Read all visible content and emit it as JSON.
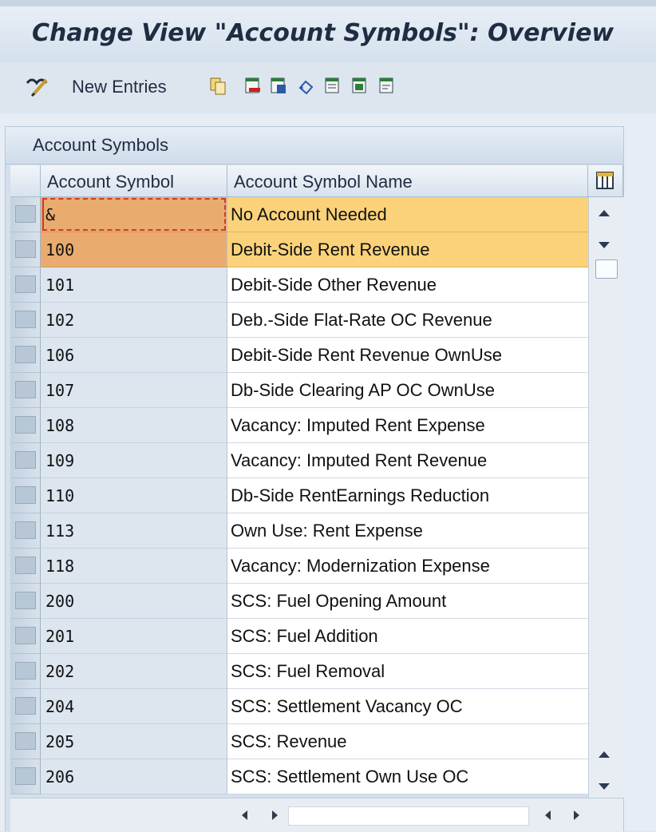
{
  "title": "Change View \"Account Symbols\": Overview",
  "toolbar": {
    "new_entries_label": "New Entries",
    "icons": [
      "glasses-pencil-icon",
      "copy-icon",
      "delete-icon",
      "undo-icon",
      "select-all-icon",
      "select-block-icon",
      "deselect-all-icon"
    ]
  },
  "panel": {
    "title": "Account Symbols",
    "columns": {
      "symbol": "Account Symbol",
      "name": "Account Symbol Name"
    }
  },
  "rows": [
    {
      "symbol": "&",
      "name": "No Account Needed"
    },
    {
      "symbol": "100",
      "name": "Debit-Side Rent Revenue"
    },
    {
      "symbol": "101",
      "name": "Debit-Side Other Revenue"
    },
    {
      "symbol": "102",
      "name": "Deb.-Side Flat-Rate OC Revenue"
    },
    {
      "symbol": "106",
      "name": "Debit-Side Rent Revenue OwnUse"
    },
    {
      "symbol": "107",
      "name": "Db-Side Clearing AP OC OwnUse"
    },
    {
      "symbol": "108",
      "name": "Vacancy: Imputed Rent Expense"
    },
    {
      "symbol": "109",
      "name": "Vacancy: Imputed Rent Revenue"
    },
    {
      "symbol": "110",
      "name": "Db-Side RentEarnings Reduction"
    },
    {
      "symbol": "113",
      "name": "Own Use: Rent Expense"
    },
    {
      "symbol": "118",
      "name": "Vacancy: Modernization Expense"
    },
    {
      "symbol": "200",
      "name": "SCS: Fuel Opening Amount"
    },
    {
      "symbol": "201",
      "name": "SCS: Fuel Addition"
    },
    {
      "symbol": "202",
      "name": "SCS: Fuel Removal"
    },
    {
      "symbol": "204",
      "name": "SCS: Settlement Vacancy OC"
    },
    {
      "symbol": "205",
      "name": "SCS: Revenue"
    },
    {
      "symbol": "206",
      "name": "SCS: Settlement Own Use OC"
    }
  ],
  "colors": {
    "selected_key": "#e9ac6e",
    "selected_text": "#fbd27a",
    "focus": "#d23a2a"
  }
}
